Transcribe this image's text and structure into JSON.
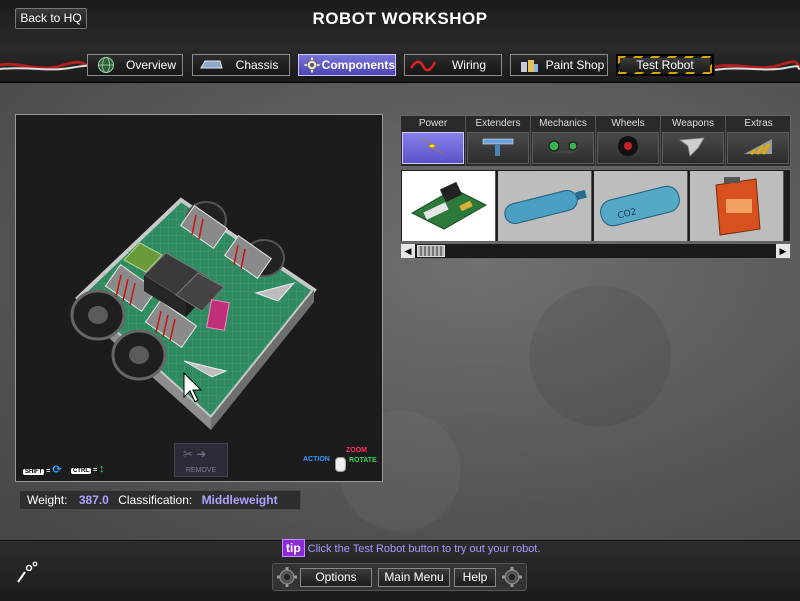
{
  "header": {
    "back_label": "Back to HQ",
    "title": "ROBOT WORKSHOP"
  },
  "tabs": [
    {
      "label": "Overview",
      "icon": "globe-icon"
    },
    {
      "label": "Chassis",
      "icon": "chassis-icon"
    },
    {
      "label": "Components",
      "icon": "gear-icon",
      "active": true
    },
    {
      "label": "Wiring",
      "icon": "wire-icon"
    },
    {
      "label": "Paint Shop",
      "icon": "paint-cans-icon"
    },
    {
      "label": "Test Robot",
      "icon": "hazard-stripes"
    }
  ],
  "viewport": {
    "shift_key": "SHIFT",
    "ctrl_key": "CTRL",
    "remove_label": "REMOVE",
    "mouse_hint": {
      "action": "ACTION",
      "zoom": "ZOOM",
      "rotate": "ROTATE"
    }
  },
  "stats": {
    "weight_label": "Weight:",
    "weight_value": "387.0",
    "class_label": "Classification:",
    "class_value": "Middleweight"
  },
  "categories": [
    {
      "label": "Power",
      "icon": "lightning-icon",
      "active": true
    },
    {
      "label": "Extenders",
      "icon": "extender-icon"
    },
    {
      "label": "Mechanics",
      "icon": "chain-gear-icon"
    },
    {
      "label": "Wheels",
      "icon": "wheel-icon"
    },
    {
      "label": "Weapons",
      "icon": "blade-icon"
    },
    {
      "label": "Extras",
      "icon": "wedge-icon"
    }
  ],
  "items": [
    {
      "name": "circuit-board",
      "selected": true
    },
    {
      "name": "blue-tank"
    },
    {
      "name": "co2-tank"
    },
    {
      "name": "nifty-power-box"
    }
  ],
  "tip": {
    "badge": "tip",
    "text": "Click the Test Robot button to try out your robot."
  },
  "footer": {
    "options": "Options",
    "main_menu": "Main Menu",
    "help": "Help"
  },
  "colors": {
    "accent": "#5b52c8",
    "value_text": "#a9a3ff",
    "hazard_yellow": "#d9a400"
  }
}
